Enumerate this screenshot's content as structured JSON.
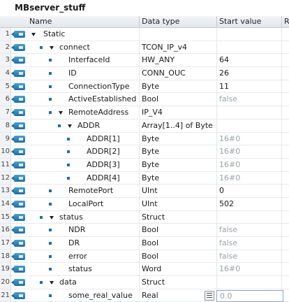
{
  "block_title": "MBserver_stuff",
  "columns": {
    "name": "Name",
    "data_type": "Data type",
    "start_value": "Start value",
    "retain": "Re"
  },
  "rows": [
    {
      "num": "1",
      "level": 0,
      "bullet": false,
      "expand": true,
      "name": "Static",
      "type": "",
      "value": "",
      "value_grey": false
    },
    {
      "num": "2",
      "level": 1,
      "bullet": true,
      "expand": true,
      "name": "connect",
      "type": "TCON_IP_v4",
      "value": "",
      "value_grey": false
    },
    {
      "num": "3",
      "level": 2,
      "bullet": true,
      "expand": false,
      "name": "InterfaceId",
      "type": "HW_ANY",
      "value": "64",
      "value_grey": false
    },
    {
      "num": "4",
      "level": 2,
      "bullet": true,
      "expand": false,
      "name": "ID",
      "type": "CONN_OUC",
      "value": "26",
      "value_grey": false
    },
    {
      "num": "5",
      "level": 2,
      "bullet": true,
      "expand": false,
      "name": "ConnectionType",
      "type": "Byte",
      "value": "11",
      "value_grey": false
    },
    {
      "num": "6",
      "level": 2,
      "bullet": true,
      "expand": false,
      "name": "ActiveEstablished",
      "type": "Bool",
      "value": "false",
      "value_grey": true
    },
    {
      "num": "7",
      "level": 2,
      "bullet": true,
      "expand": true,
      "name": "RemoteAddress",
      "type": "IP_V4",
      "value": "",
      "value_grey": false
    },
    {
      "num": "8",
      "level": 3,
      "bullet": true,
      "expand": true,
      "name": "ADDR",
      "type": "Array[1..4] of Byte",
      "value": "",
      "value_grey": false
    },
    {
      "num": "9",
      "level": 4,
      "bullet": true,
      "expand": false,
      "name": "ADDR[1]",
      "type": "Byte",
      "value": "16#0",
      "value_grey": true
    },
    {
      "num": "10",
      "level": 4,
      "bullet": true,
      "expand": false,
      "name": "ADDR[2]",
      "type": "Byte",
      "value": "16#0",
      "value_grey": true
    },
    {
      "num": "11",
      "level": 4,
      "bullet": true,
      "expand": false,
      "name": "ADDR[3]",
      "type": "Byte",
      "value": "16#0",
      "value_grey": true
    },
    {
      "num": "12",
      "level": 4,
      "bullet": true,
      "expand": false,
      "name": "ADDR[4]",
      "type": "Byte",
      "value": "16#0",
      "value_grey": true
    },
    {
      "num": "13",
      "level": 2,
      "bullet": true,
      "expand": false,
      "name": "RemotePort",
      "type": "UInt",
      "value": "0",
      "value_grey": false
    },
    {
      "num": "14",
      "level": 2,
      "bullet": true,
      "expand": false,
      "name": "LocalPort",
      "type": "UInt",
      "value": "502",
      "value_grey": false
    },
    {
      "num": "15",
      "level": 1,
      "bullet": true,
      "expand": true,
      "name": "status",
      "type": "Struct",
      "value": "",
      "value_grey": false
    },
    {
      "num": "16",
      "level": 2,
      "bullet": true,
      "expand": false,
      "name": "NDR",
      "type": "Bool",
      "value": "false",
      "value_grey": true
    },
    {
      "num": "17",
      "level": 2,
      "bullet": true,
      "expand": false,
      "name": "DR",
      "type": "Bool",
      "value": "false",
      "value_grey": true
    },
    {
      "num": "18",
      "level": 2,
      "bullet": true,
      "expand": false,
      "name": "error",
      "type": "Bool",
      "value": "false",
      "value_grey": true
    },
    {
      "num": "19",
      "level": 2,
      "bullet": true,
      "expand": false,
      "name": "status",
      "type": "Word",
      "value": "16#0",
      "value_grey": true
    },
    {
      "num": "20",
      "level": 1,
      "bullet": true,
      "expand": true,
      "name": "data",
      "type": "Struct",
      "value": "",
      "value_grey": false
    },
    {
      "num": "21",
      "level": 2,
      "bullet": true,
      "expand": false,
      "name": "some_real_value",
      "type": "Real",
      "value": "0.0",
      "value_grey": true,
      "editing": true
    }
  ],
  "icons": {
    "interface": "interface-io-icon",
    "expand": "expand-triangle-icon",
    "member": "member-bullet-icon",
    "picker": "value-picker-icon"
  }
}
